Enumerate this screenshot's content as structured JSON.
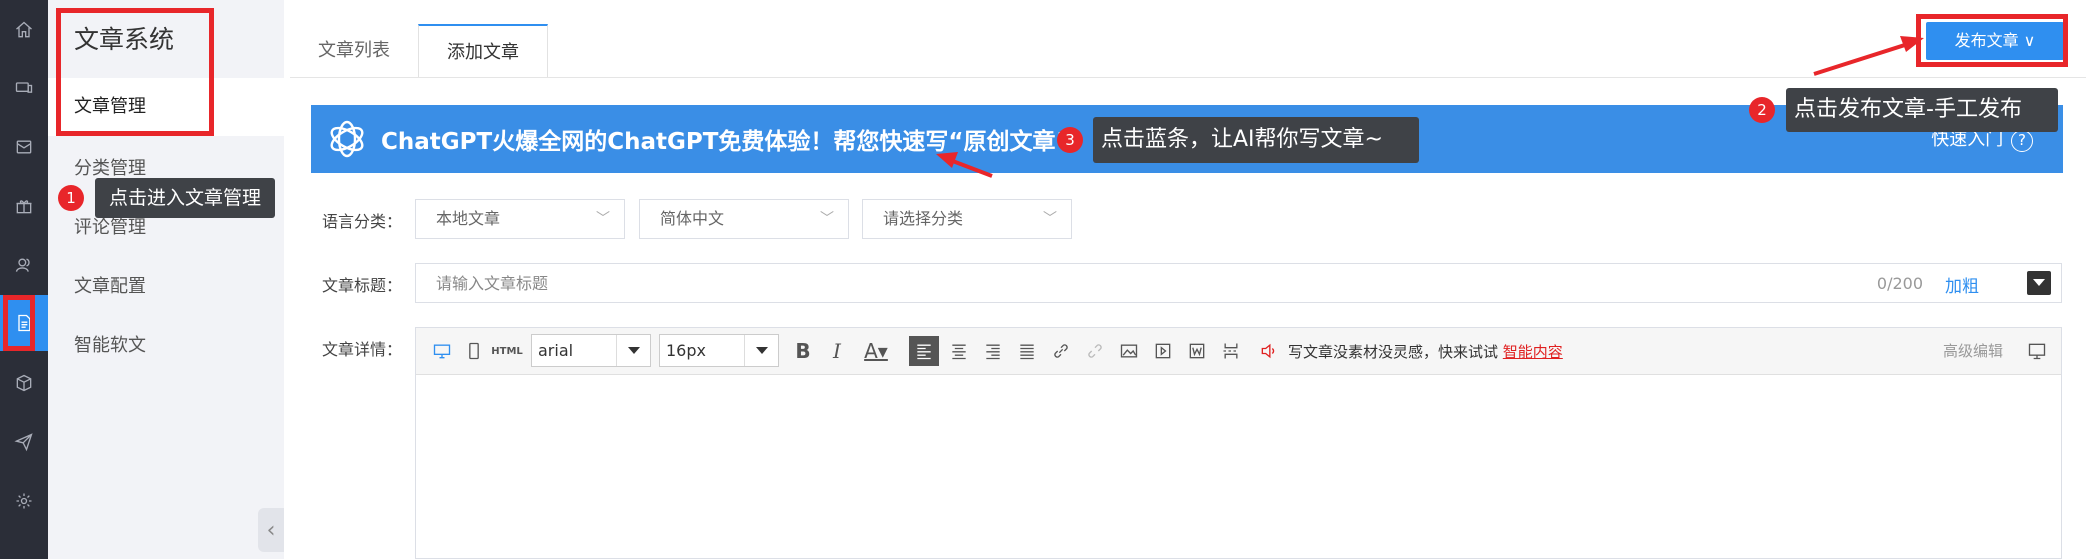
{
  "rail": {
    "items": [
      {
        "icon": "home-icon"
      },
      {
        "icon": "monitor-icon"
      },
      {
        "icon": "mail-icon"
      },
      {
        "icon": "gift-icon"
      },
      {
        "icon": "users-icon"
      },
      {
        "icon": "document-icon",
        "active": true
      },
      {
        "icon": "cube-icon"
      },
      {
        "icon": "send-icon"
      },
      {
        "icon": "settings-icon"
      }
    ]
  },
  "menu": {
    "title": "文章系统",
    "items": [
      "文章管理",
      "分类管理",
      "评论管理",
      "文章配置",
      "智能软文"
    ]
  },
  "tabs": [
    "文章列表",
    "添加文章"
  ],
  "header": {
    "publish_label": "发布文章 ∨"
  },
  "banner": {
    "text": "ChatGPT火爆全网的ChatGPT免费体验！帮您快速写“原创文章”",
    "right_text": "快速入门",
    "help": "?"
  },
  "form": {
    "language_label": "语言分类：",
    "selects": [
      "本地文章",
      "简体中文",
      "请选择分类"
    ],
    "title_label": "文章标题：",
    "title_placeholder": "请输入文章标题",
    "title_counter": "0/200",
    "bold_label": "加粗",
    "detail_label": "文章详情："
  },
  "editor": {
    "font": "arial",
    "size": "16px",
    "tip": "写文章没素材没灵感，快来试试",
    "tip_link": "智能内容",
    "advanced": "高级编辑"
  },
  "annotations": {
    "tip1": "点击进入文章管理",
    "tip2": "点击发布文章-手工发布",
    "tip3": "点击蓝条，让AI帮你写文章~",
    "n1": "1",
    "n2": "2",
    "n3": "3"
  },
  "colors": {
    "accent": "#2f8ff0",
    "rail_bg": "#2b2e38",
    "annotation_red": "#e8262a",
    "tooltip_bg": "#3f4247"
  }
}
